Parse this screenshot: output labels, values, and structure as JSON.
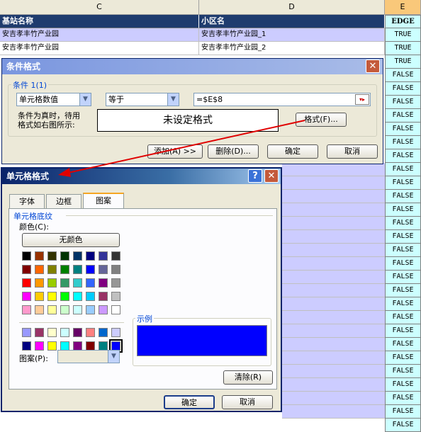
{
  "sheet": {
    "col_c": "C",
    "col_d": "D",
    "col_e": "E",
    "header_c": "基站名称",
    "header_d": "小区名",
    "header_e": "EDGE",
    "rows": [
      {
        "c": "安吉孝丰竹产业园",
        "d": "安吉孝丰竹产业园_1"
      },
      {
        "c": "安吉孝丰竹产业园",
        "d": "安吉孝丰竹产业园_2"
      }
    ],
    "e_values": [
      "TRUE",
      "TRUE",
      "TRUE",
      "FALSE",
      "FALSE",
      "FALSE",
      "FALSE",
      "FALSE",
      "FALSE",
      "FALSE",
      "FALSE",
      "FALSE",
      "FALSE",
      "FALSE",
      "FALSE",
      "FALSE",
      "FALSE",
      "FALSE",
      "FALSE",
      "FALSE",
      "FALSE",
      "FALSE",
      "FALSE",
      "FALSE",
      "FALSE",
      "FALSE",
      "FALSE",
      "FALSE",
      "FALSE",
      "FALSE"
    ]
  },
  "cond_dialog": {
    "title": "条件格式",
    "condition_group": "条件 1(1)",
    "type_value": "单元格数值",
    "operator_value": "等于",
    "formula_value": "=$E$8",
    "preview_label": "条件为真时，待用\n格式如右图所示:",
    "preview_text": "未设定格式",
    "format_button": "格式(F)...",
    "add_button": "添加(A) >>",
    "delete_button": "删除(D)...",
    "ok_button": "确定",
    "cancel_button": "取消"
  },
  "format_dialog": {
    "title": "单元格格式",
    "tabs": [
      "字体",
      "边框",
      "图案"
    ],
    "active_tab": "图案",
    "shading_group": "单元格底纹",
    "color_label": "颜色(C):",
    "no_color_button": "无颜色",
    "sample_group": "示例",
    "pattern_label": "图案(P):",
    "clear_button": "清除(R)",
    "ok_button": "确定",
    "cancel_button": "取消",
    "sample_color": "#0000ff",
    "palette_main": [
      [
        "#000000",
        "#993300",
        "#333300",
        "#003300",
        "#003366",
        "#000080",
        "#333399",
        "#333333"
      ],
      [
        "#800000",
        "#ff6600",
        "#808000",
        "#008000",
        "#008080",
        "#0000ff",
        "#666699",
        "#808080"
      ],
      [
        "#ff0000",
        "#ff9900",
        "#99cc00",
        "#339966",
        "#33cccc",
        "#3366ff",
        "#800080",
        "#969696"
      ],
      [
        "#ff00ff",
        "#ffcc00",
        "#ffff00",
        "#00ff00",
        "#00ffff",
        "#00ccff",
        "#993366",
        "#c0c0c0"
      ],
      [
        "#ff99cc",
        "#ffcc99",
        "#ffff99",
        "#ccffcc",
        "#ccffff",
        "#99ccff",
        "#cc99ff",
        "#ffffff"
      ]
    ],
    "palette_extra": [
      [
        "#9999ff",
        "#993366",
        "#ffffcc",
        "#ccffff",
        "#660066",
        "#ff8080",
        "#0066cc",
        "#ccccff"
      ],
      [
        "#000080",
        "#ff00ff",
        "#ffff00",
        "#00ffff",
        "#800080",
        "#800000",
        "#008080",
        "#0000ff"
      ]
    ]
  }
}
